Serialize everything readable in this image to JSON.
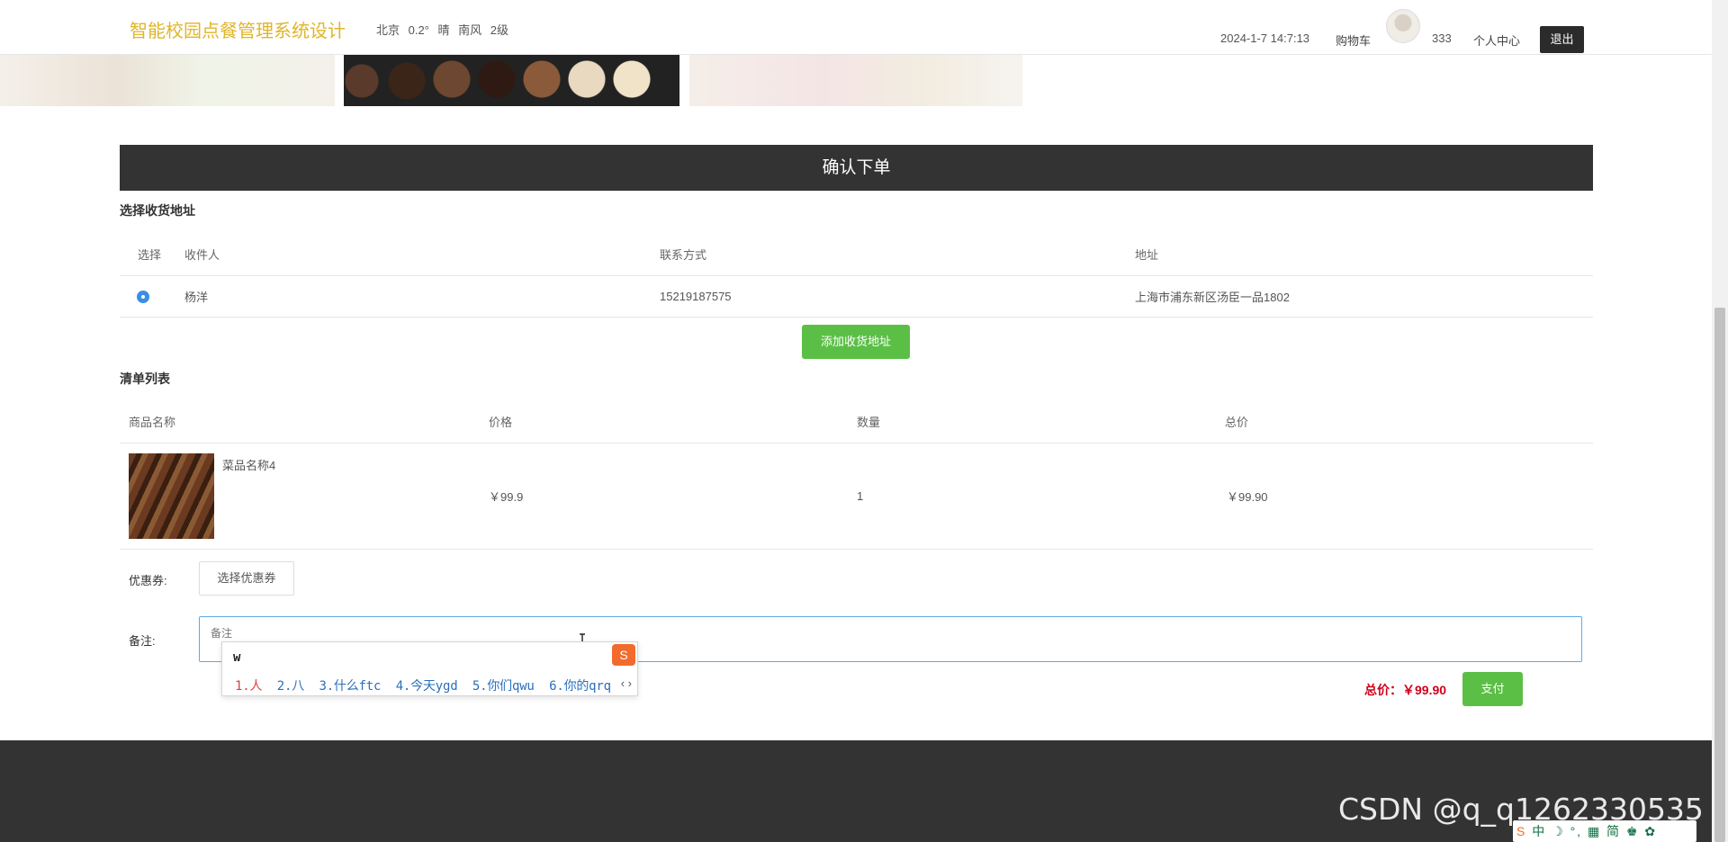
{
  "header": {
    "title": "智能校园点餐管理系统设计",
    "weather": "北京 0.2° 晴 南风 2级",
    "datetime": "2024-1-7 14:7:13",
    "cart": "购物车",
    "username": "333",
    "user_center": "个人中心",
    "logout": "退出"
  },
  "confirm_title": "确认下单",
  "address": {
    "section_title": "选择收货地址",
    "columns": [
      "选择",
      "收件人",
      "联系方式",
      "地址"
    ],
    "rows": [
      {
        "selected": true,
        "name": "杨洋",
        "phone": "15219187575",
        "addr": "上海市浦东新区汤臣一品1802"
      }
    ],
    "add_button": "添加收货地址"
  },
  "list": {
    "section_title": "清单列表",
    "columns": [
      "商品名称",
      "价格",
      "数量",
      "总价"
    ],
    "rows": [
      {
        "name": "菜品名称4",
        "price": "￥99.9",
        "qty": "1",
        "total": "￥99.90"
      }
    ]
  },
  "coupon": {
    "label": "优惠券:",
    "button": "选择优惠券"
  },
  "note": {
    "label": "备注:",
    "placeholder": "备注"
  },
  "summary": {
    "total": "总价：￥99.90",
    "pay": "支付"
  },
  "ime": {
    "input": "w",
    "candidates": [
      "1.人",
      "2.八",
      "3.什么ftc",
      "4.今天ygd",
      "5.你们qwu",
      "6.你的qrq"
    ],
    "arrows": "‹ ›",
    "logo": "S"
  },
  "watermark": "CSDN @q_q1262330535",
  "ime_toolbar": "中 ☽ °, ▦ 简 ♚ ✿",
  "colors": {
    "accent_green": "#5bbf46",
    "header_title": "#e0b52a",
    "dark_bar": "#333333",
    "price_red": "#d0021b"
  }
}
